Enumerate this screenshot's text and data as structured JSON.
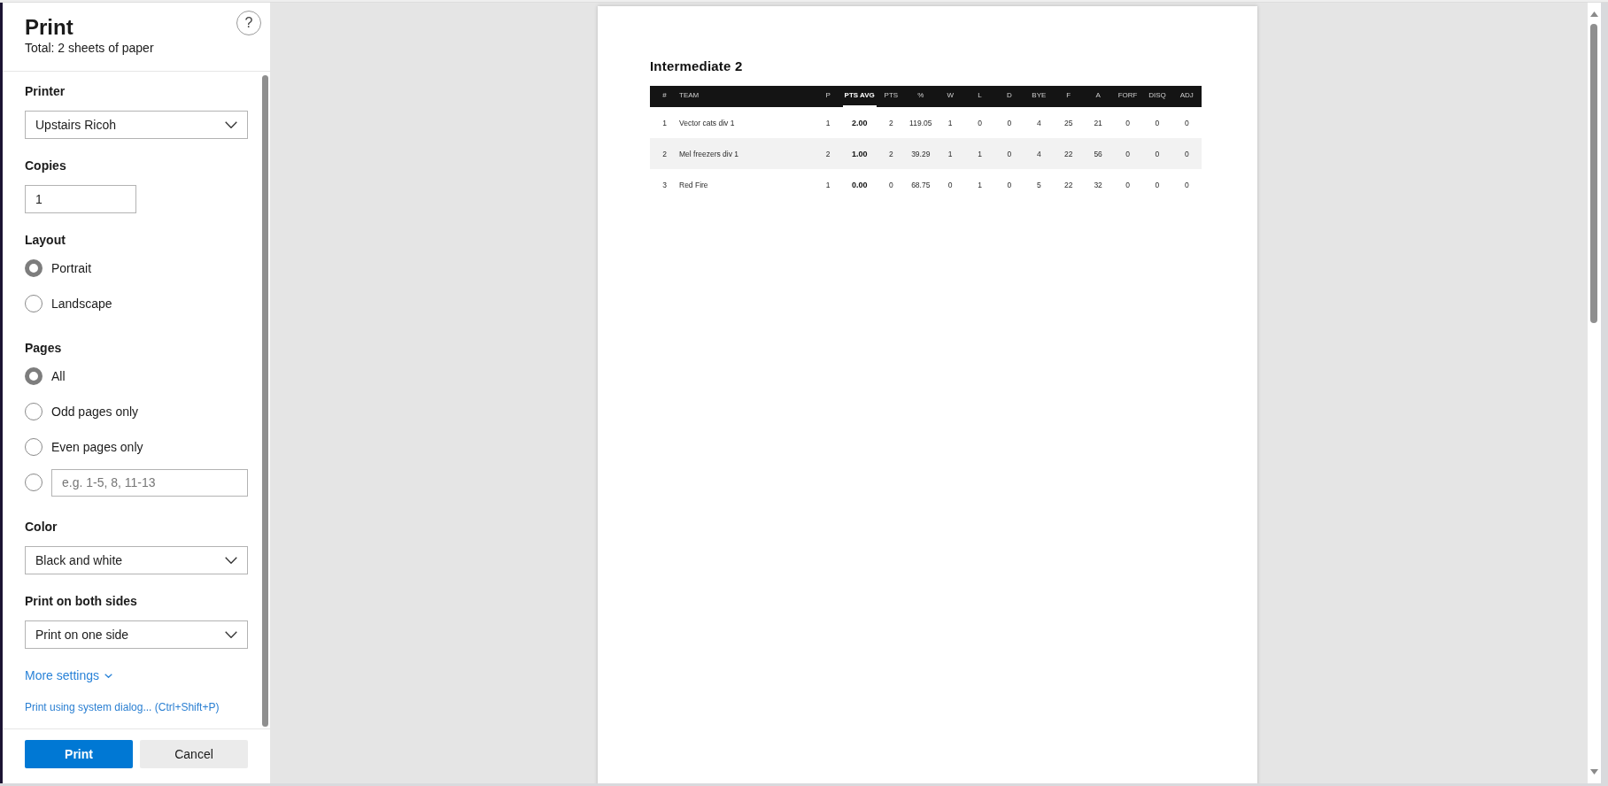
{
  "dialog": {
    "title": "Print",
    "summary": "Total: 2 sheets of paper",
    "help": "?"
  },
  "settings": [
    {
      "kind": "select",
      "label": "Printer",
      "value": "Upstairs Ricoh"
    },
    {
      "kind": "input",
      "label": "Copies",
      "value": "1"
    },
    {
      "kind": "radio",
      "label": "Layout",
      "options": [
        {
          "kind": "text",
          "label": "Portrait",
          "selected": true
        },
        {
          "kind": "text",
          "label": "Landscape",
          "selected": false
        }
      ]
    },
    {
      "kind": "radio",
      "label": "Pages",
      "options": [
        {
          "kind": "text",
          "label": "All",
          "selected": true
        },
        {
          "kind": "text",
          "label": "Odd pages only",
          "selected": false
        },
        {
          "kind": "text",
          "label": "Even pages only",
          "selected": false
        },
        {
          "kind": "range",
          "placeholder": "e.g. 1-5, 8, 11-13",
          "selected": false
        }
      ]
    },
    {
      "kind": "select",
      "label": "Color",
      "value": "Black and white"
    },
    {
      "kind": "select",
      "label": "Print on both sides",
      "value": "Print on one side"
    }
  ],
  "more_settings": {
    "label": "More settings",
    "expanded": false
  },
  "system_dialog_link": "Print using system dialog... (Ctrl+Shift+P)",
  "buttons": [
    {
      "kind": "primary",
      "label": "Print"
    },
    {
      "kind": "secondary",
      "label": "Cancel"
    }
  ],
  "preview": {
    "heading": "Intermediate 2",
    "table": {
      "columns": [
        {
          "kind": "number",
          "label": "#",
          "sorted": false
        },
        {
          "kind": "text",
          "label": "TEAM",
          "sorted": false
        },
        {
          "kind": "number",
          "label": "P",
          "sorted": false
        },
        {
          "kind": "number",
          "label": "PTS AVG",
          "sorted": true
        },
        {
          "kind": "number",
          "label": "PTS",
          "sorted": false
        },
        {
          "kind": "number",
          "label": "%",
          "sorted": false
        },
        {
          "kind": "number",
          "label": "W",
          "sorted": false
        },
        {
          "kind": "number",
          "label": "L",
          "sorted": false
        },
        {
          "kind": "number",
          "label": "D",
          "sorted": false
        },
        {
          "kind": "number",
          "label": "BYE",
          "sorted": false
        },
        {
          "kind": "number",
          "label": "F",
          "sorted": false
        },
        {
          "kind": "number",
          "label": "A",
          "sorted": false
        },
        {
          "kind": "number",
          "label": "FORF",
          "sorted": false
        },
        {
          "kind": "number",
          "label": "DISQ",
          "sorted": false
        },
        {
          "kind": "number",
          "label": "ADJ",
          "sorted": false
        }
      ],
      "rows": [
        [
          "1",
          "Vector cats div 1",
          "1",
          "2.00",
          "2",
          "119.05",
          "1",
          "0",
          "0",
          "4",
          "25",
          "21",
          "0",
          "0",
          "0"
        ],
        [
          "2",
          "Mel freezers div 1",
          "2",
          "1.00",
          "2",
          "39.29",
          "1",
          "1",
          "0",
          "4",
          "22",
          "56",
          "0",
          "0",
          "0"
        ],
        [
          "3",
          "Red Fire",
          "1",
          "0.00",
          "0",
          "68.75",
          "0",
          "1",
          "0",
          "5",
          "22",
          "32",
          "0",
          "0",
          "0"
        ]
      ]
    }
  }
}
